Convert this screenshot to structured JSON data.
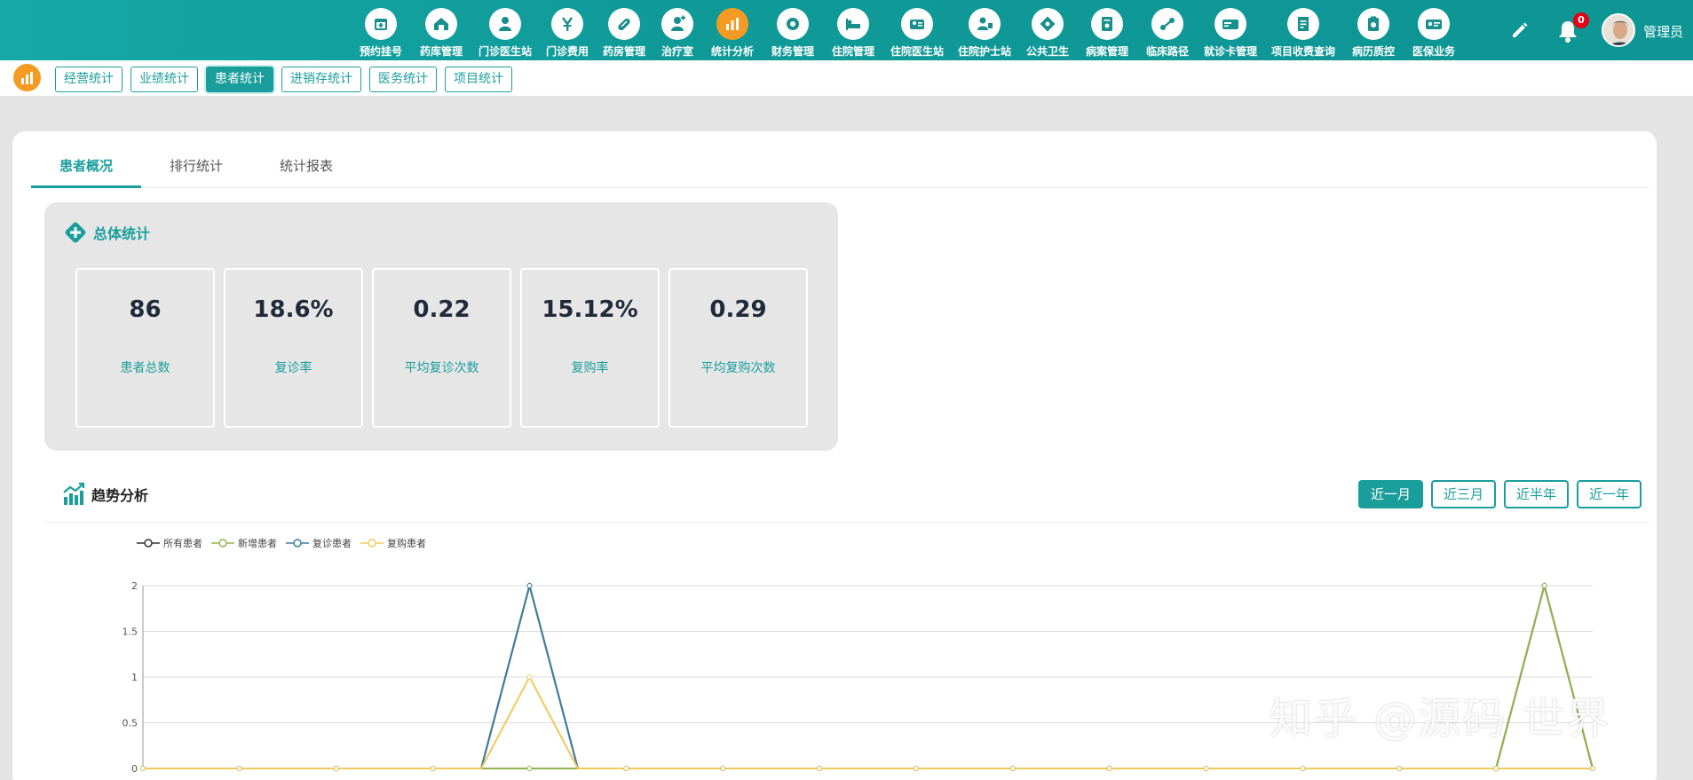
{
  "nav": [
    {
      "label": "预约挂号",
      "icon": "calendar-icon"
    },
    {
      "label": "药库管理",
      "icon": "warehouse-icon"
    },
    {
      "label": "门诊医生站",
      "icon": "doctor-icon"
    },
    {
      "label": "门诊费用",
      "icon": "yen-icon"
    },
    {
      "label": "药房管理",
      "icon": "pill-icon"
    },
    {
      "label": "治疗室",
      "icon": "nurse-icon"
    },
    {
      "label": "统计分析",
      "icon": "bar-chart-icon",
      "active": true
    },
    {
      "label": "财务管理",
      "icon": "gear-icon"
    },
    {
      "label": "住院管理",
      "icon": "bed-icon"
    },
    {
      "label": "住院医生站",
      "icon": "id-card-icon"
    },
    {
      "label": "住院护士站",
      "icon": "nurse-card-icon"
    },
    {
      "label": "公共卫生",
      "icon": "diamond-icon"
    },
    {
      "label": "病案管理",
      "icon": "file-icon"
    },
    {
      "label": "临床路径",
      "icon": "path-icon"
    },
    {
      "label": "就诊卡管理",
      "icon": "card-icon"
    },
    {
      "label": "项目收费查询",
      "icon": "receipt-icon"
    },
    {
      "label": "病历质控",
      "icon": "clipboard-icon"
    },
    {
      "label": "医保业务",
      "icon": "insurance-icon"
    }
  ],
  "header": {
    "badge_count": "0",
    "username": "管理员"
  },
  "subtabs": [
    "经营统计",
    "业绩统计",
    "患者统计",
    "进销存统计",
    "医务统计",
    "项目统计"
  ],
  "subtab_active": "患者统计",
  "page_tabs": [
    "患者概况",
    "排行统计",
    "统计报表"
  ],
  "summary": {
    "title": "总体统计",
    "stats": [
      {
        "value": "86",
        "label": "患者总数"
      },
      {
        "value": "18.6%",
        "label": "复诊率"
      },
      {
        "value": "0.22",
        "label": "平均复诊次数"
      },
      {
        "value": "15.12%",
        "label": "复购率"
      },
      {
        "value": "0.29",
        "label": "平均复购次数"
      }
    ]
  },
  "trend": {
    "title": "趋势分析",
    "ranges": [
      "近一月",
      "近三月",
      "近半年",
      "近一年"
    ]
  },
  "colors": {
    "primary": "#1a9e9c",
    "accent": "#f59a23",
    "badge": "#e60012"
  },
  "chart_data": {
    "type": "line",
    "title": "",
    "xlabel": "",
    "ylabel": "",
    "ylim": [
      0,
      2
    ],
    "yticks": [
      "0",
      "0.5",
      "1",
      "1.5",
      "2"
    ],
    "legend_position": "top-left",
    "grid": true,
    "x_count": 31,
    "visible_x_index_range": [
      0,
      30
    ],
    "series": [
      {
        "name": "所有患者",
        "color": "#333333",
        "values": [
          0,
          0,
          0,
          0,
          0,
          0,
          0,
          0,
          2,
          0,
          0,
          0,
          0,
          0,
          0,
          0,
          0,
          0,
          0,
          0,
          0,
          0,
          0,
          0,
          0,
          0,
          0,
          0,
          0,
          2,
          0
        ]
      },
      {
        "name": "新增患者",
        "color": "#91b54e",
        "values": [
          0,
          0,
          0,
          0,
          0,
          0,
          0,
          0,
          0,
          0,
          0,
          0,
          0,
          0,
          0,
          0,
          0,
          0,
          0,
          0,
          0,
          0,
          0,
          0,
          0,
          0,
          0,
          0,
          0,
          2,
          0
        ]
      },
      {
        "name": "复诊患者",
        "color": "#3f7fa0",
        "values": [
          0,
          0,
          0,
          0,
          0,
          0,
          0,
          0,
          2,
          0,
          0,
          0,
          0,
          0,
          0,
          0,
          0,
          0,
          0,
          0,
          0,
          0,
          0,
          0,
          0,
          0,
          0,
          0,
          0,
          0,
          0
        ]
      },
      {
        "name": "复购患者",
        "color": "#f0c95b",
        "values": [
          0,
          0,
          0,
          0,
          0,
          0,
          0,
          0,
          1,
          0,
          0,
          0,
          0,
          0,
          0,
          0,
          0,
          0,
          0,
          0,
          0,
          0,
          0,
          0,
          0,
          0,
          0,
          0,
          0,
          0,
          0
        ]
      }
    ]
  },
  "watermark": "知乎 @源码 世界"
}
